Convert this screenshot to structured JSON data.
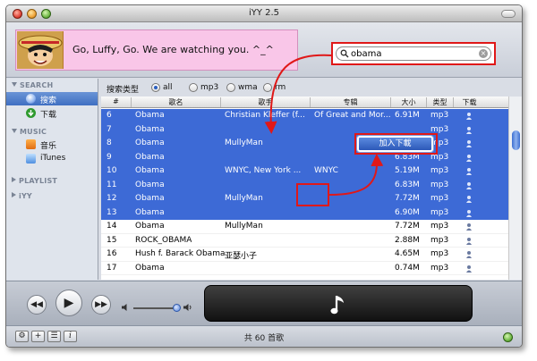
{
  "window": {
    "title": "iYY 2.5"
  },
  "banner": {
    "now_playing": "Go, Luffy, Go. We are watching you. ^_^"
  },
  "search": {
    "value": "obama"
  },
  "sidebar": {
    "sections": [
      {
        "title": "SEARCH",
        "items": [
          "搜索",
          "下载"
        ]
      },
      {
        "title": "MUSIC",
        "items": [
          "音乐",
          "iTunes"
        ]
      },
      {
        "title": "PLAYLIST",
        "items": []
      },
      {
        "title": "iYY",
        "items": []
      }
    ],
    "selected_item": "搜索"
  },
  "filter": {
    "label": "搜索类型",
    "options": [
      "all",
      "mp3",
      "wma",
      "rm"
    ],
    "selected": "all"
  },
  "table": {
    "columns": [
      "#",
      "歌名",
      "歌手",
      "专辑",
      "大小",
      "类型",
      "下载"
    ],
    "rows": [
      {
        "num": "6",
        "title": "Obama",
        "artist": "Christian Kleffer (f...",
        "album": "Of Great and Mor...",
        "size": "6.91M",
        "type": "mp3",
        "selected": true
      },
      {
        "num": "7",
        "title": "Obama",
        "artist": "",
        "album": "",
        "size": "",
        "type": "mp3",
        "selected": true
      },
      {
        "num": "8",
        "title": "Obama",
        "artist": "MullyMan",
        "album": "",
        "size": "",
        "type": "mp3",
        "selected": true
      },
      {
        "num": "9",
        "title": "Obama",
        "artist": "",
        "album": "",
        "size": "6.83M",
        "type": "mp3",
        "selected": true
      },
      {
        "num": "10",
        "title": "Obama",
        "artist": "WNYC, New York ...",
        "album": "WNYC",
        "size": "5.19M",
        "type": "mp3",
        "selected": true
      },
      {
        "num": "11",
        "title": "Obama",
        "artist": "",
        "album": "",
        "size": "6.83M",
        "type": "mp3",
        "selected": true
      },
      {
        "num": "12",
        "title": "Obama",
        "artist": "MullyMan",
        "album": "",
        "size": "7.72M",
        "type": "mp3",
        "selected": true
      },
      {
        "num": "13",
        "title": "Obama",
        "artist": "",
        "album": "",
        "size": "6.90M",
        "type": "mp3",
        "selected": true
      },
      {
        "num": "14",
        "title": "Obama",
        "artist": "MullyMan",
        "album": "",
        "size": "7.72M",
        "type": "mp3",
        "selected": false
      },
      {
        "num": "15",
        "title": "ROCK_OBAMA",
        "artist": "",
        "album": "",
        "size": "2.88M",
        "type": "mp3",
        "selected": false
      },
      {
        "num": "16",
        "title": "Hush f. Barack Obama",
        "artist": "亚瑟小子",
        "album": "",
        "size": "4.65M",
        "type": "mp3",
        "selected": false
      },
      {
        "num": "17",
        "title": "Obama",
        "artist": "",
        "album": "",
        "size": "0.74M",
        "type": "mp3",
        "selected": false
      }
    ]
  },
  "context_menu": {
    "label": "加入下載"
  },
  "status": {
    "text": "共 60 首歌"
  },
  "colors": {
    "accent": "#e01818",
    "selection": "#3d6ad6",
    "banner": "#f9c6e8"
  }
}
